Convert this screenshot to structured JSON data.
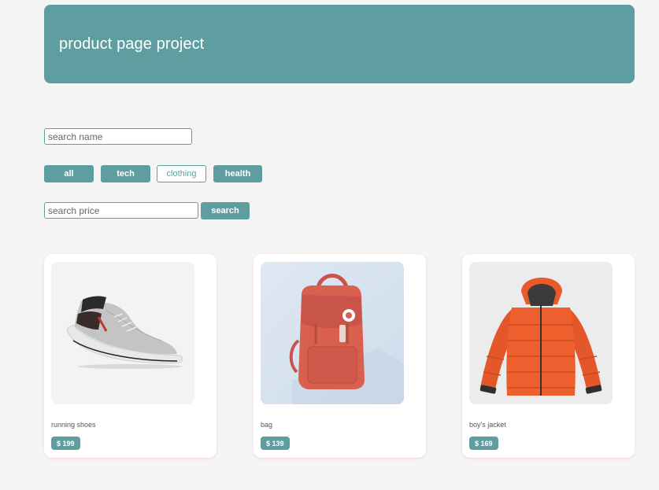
{
  "header": {
    "title": "product page project"
  },
  "filters": {
    "name_placeholder": "search name",
    "categories": [
      {
        "label": "all",
        "active": true
      },
      {
        "label": "tech",
        "active": true
      },
      {
        "label": "clothing",
        "active": false
      },
      {
        "label": "health",
        "active": true
      }
    ],
    "price_placeholder": "search price",
    "search_label": "search"
  },
  "products": [
    {
      "name": "running shoes",
      "price": "$ 199",
      "image": "running-shoe-image"
    },
    {
      "name": "bag",
      "price": "$ 139",
      "image": "backpack-image"
    },
    {
      "name": "boy's jacket",
      "price": "$ 169",
      "image": "puffer-jacket-image"
    }
  ],
  "colors": {
    "accent": "#5f9ea0",
    "background": "#f5f5f5",
    "card": "#ffffff"
  }
}
